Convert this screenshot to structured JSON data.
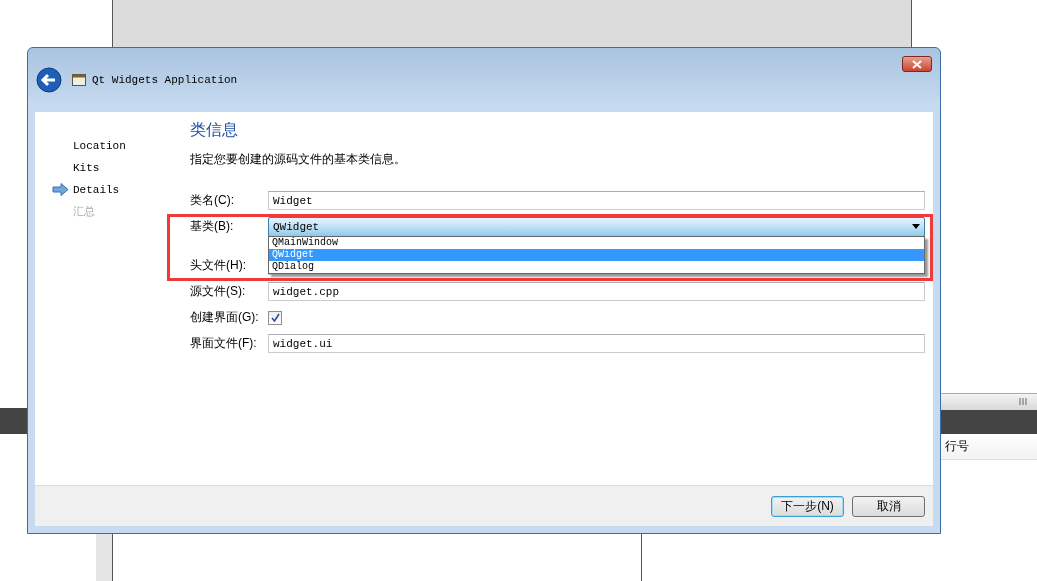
{
  "background": {
    "column_header": "行号"
  },
  "dialog": {
    "title": "Qt Widgets Application",
    "steps": [
      {
        "label": "Location",
        "selected": false,
        "upcoming": false
      },
      {
        "label": "Kits",
        "selected": false,
        "upcoming": false
      },
      {
        "label": "Details",
        "selected": true,
        "upcoming": false
      },
      {
        "label": "汇总",
        "selected": false,
        "upcoming": true
      }
    ],
    "page": {
      "heading": "类信息",
      "description": "指定您要创建的源码文件的基本类信息。",
      "fields": [
        {
          "kind": "text",
          "label": "类名(C):",
          "value": "Widget"
        },
        {
          "kind": "combo",
          "label": "基类(B):",
          "value": "QWidget",
          "expanded": true,
          "options": [
            {
              "label": "QMainWindow",
              "selected": false
            },
            {
              "label": "QWidget",
              "selected": true
            },
            {
              "label": "QDialog",
              "selected": false
            }
          ]
        },
        {
          "kind": "text",
          "label": "头文件(H):"
        },
        {
          "kind": "text",
          "label": "源文件(S):",
          "value": "widget.cpp"
        },
        {
          "kind": "checkbox",
          "label": "创建界面(G):",
          "checked": true
        },
        {
          "kind": "text",
          "label": "界面文件(F):",
          "value": "widget.ui"
        }
      ]
    },
    "buttons": [
      {
        "label": "下一步(N)",
        "default": true
      },
      {
        "label": "取消",
        "default": false
      }
    ]
  }
}
